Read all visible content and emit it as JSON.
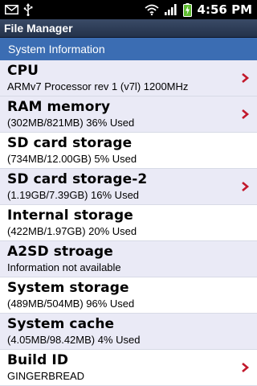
{
  "status_bar": {
    "time": "4:56 PM",
    "icons": [
      "mail-icon",
      "usb-icon",
      "wifi-icon",
      "signal-icon",
      "battery-charging-icon"
    ]
  },
  "app": {
    "title": "File Manager"
  },
  "section": {
    "title": "System Information"
  },
  "colors": {
    "section_header": "#3b6db3",
    "alt_row": "#eaeaf6",
    "chevron": "#c2182b"
  },
  "items": [
    {
      "title": "CPU",
      "subtitle": "ARMv7 Processor rev 1 (v7l)  1200MHz",
      "has_chevron": true
    },
    {
      "title": "RAM memory",
      "subtitle": "(302MB/821MB) 36% Used",
      "has_chevron": true
    },
    {
      "title": "SD card storage",
      "subtitle": "(734MB/12.00GB) 5% Used",
      "has_chevron": false
    },
    {
      "title": "SD card storage-2",
      "subtitle": "(1.19GB/7.39GB) 16% Used",
      "has_chevron": true
    },
    {
      "title": "Internal storage",
      "subtitle": "(422MB/1.97GB) 20% Used",
      "has_chevron": false
    },
    {
      "title": "A2SD stroage",
      "subtitle": "Information not available",
      "has_chevron": false
    },
    {
      "title": "System storage",
      "subtitle": "(489MB/504MB) 96% Used",
      "has_chevron": false
    },
    {
      "title": "System cache",
      "subtitle": "(4.05MB/98.42MB) 4% Used",
      "has_chevron": false
    },
    {
      "title": "Build ID",
      "subtitle": "GINGERBREAD",
      "has_chevron": true
    }
  ]
}
